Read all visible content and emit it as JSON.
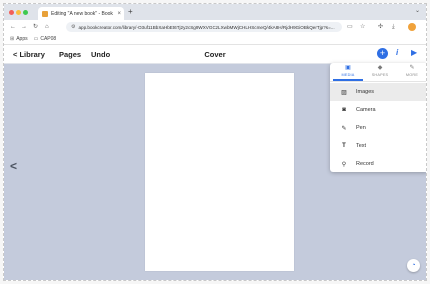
{
  "browser": {
    "tab_title": "Editing \"A new book\" - Book",
    "tab_close": "×",
    "new_tab": "+",
    "window_control": "⌄",
    "url": "app.bookcreator.com/library/-O3uf11BbXaHbEt6Tj2y2cSg9WXVGCzLXwbMWjCHLHScmeQ/4kA8H/RjdH9GiOBkQerTjp?s=...",
    "bookmarks": [
      {
        "icon": "apps-grid-icon",
        "label": "Apps"
      },
      {
        "icon": "folder-icon",
        "label": "CAP08"
      }
    ]
  },
  "header": {
    "library": "< Library",
    "pages": "Pages",
    "undo": "Undo",
    "title": "Cover"
  },
  "insert_menu": {
    "tabs": [
      {
        "label": "MEDIA",
        "icon": "media-icon",
        "active": true
      },
      {
        "label": "SHAPES",
        "icon": "shapes-icon",
        "active": false
      },
      {
        "label": "MORE",
        "icon": "more-icon",
        "active": false
      }
    ],
    "items": [
      {
        "label": "Images",
        "icon": "image-icon",
        "selected": true
      },
      {
        "label": "Camera",
        "icon": "camera-icon",
        "selected": false
      },
      {
        "label": "Pen",
        "icon": "pen-icon",
        "selected": false
      },
      {
        "label": "Text",
        "icon": "text-icon",
        "selected": false
      },
      {
        "label": "Record",
        "icon": "microphone-icon",
        "selected": false
      }
    ]
  },
  "colors": {
    "accent": "#2f6fe4",
    "workspace": "#c4cbdc"
  }
}
